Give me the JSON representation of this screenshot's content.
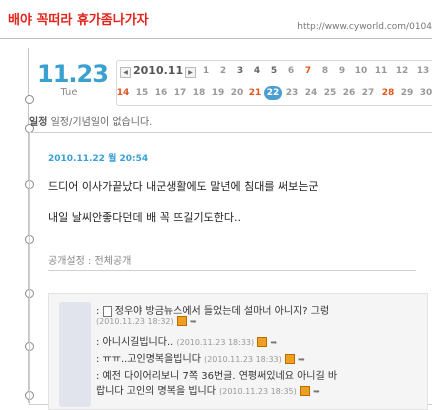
{
  "header": {
    "title": "배야 꼭떠라 휴가좀나가자",
    "url": "http://www.cyworld.com/0104"
  },
  "calendar": {
    "big_date": "11.23",
    "day": "Tue",
    "month_label": "2010.11",
    "prev_icon": "triangle-left-icon",
    "next_icon": "triangle-right-icon",
    "row1": [
      "1",
      "2",
      "3",
      "4",
      "5",
      "6",
      "7",
      "8",
      "9",
      "10",
      "11",
      "12",
      "13"
    ],
    "row2": [
      "14",
      "15",
      "16",
      "17",
      "18",
      "19",
      "20",
      "21",
      "22",
      "23",
      "24",
      "25",
      "26",
      "27",
      "28",
      "29",
      "30"
    ],
    "selected": "22",
    "accent": "#3aa0cf"
  },
  "schedule": {
    "label": "일정",
    "text": "일정/기념일이 없습니다."
  },
  "post": {
    "date": "2010.11.22 월  20:54",
    "line1": "드디어 이사가끝났다 내군생활에도 말년에 침대를 써보는군",
    "line2": "내일 날씨안좋다던데 배 꼭 뜨길기도한다..",
    "share": "공개설정 : 전체공개"
  },
  "comments": [
    {
      "text": "정우야 방금뉴스에서 들었는데 설마너 아니지? 그렁",
      "time": "(2010.11.23 18:32)"
    },
    {
      "text": ": 아니시길빕니다..",
      "time": "(2010.11.23 18:33)"
    },
    {
      "text": ": ㅠㅠ..고인명복을빕니다",
      "time": "(2010.11.23 18:33)"
    },
    {
      "text": ": 예전 다이어리보니 7쪽 36번글. 연평써있네요 아니길 바",
      "time": ""
    },
    {
      "text": "랍니다 고인의 명복을 빕니다",
      "time": "(2010.11.23 18:35)"
    }
  ]
}
